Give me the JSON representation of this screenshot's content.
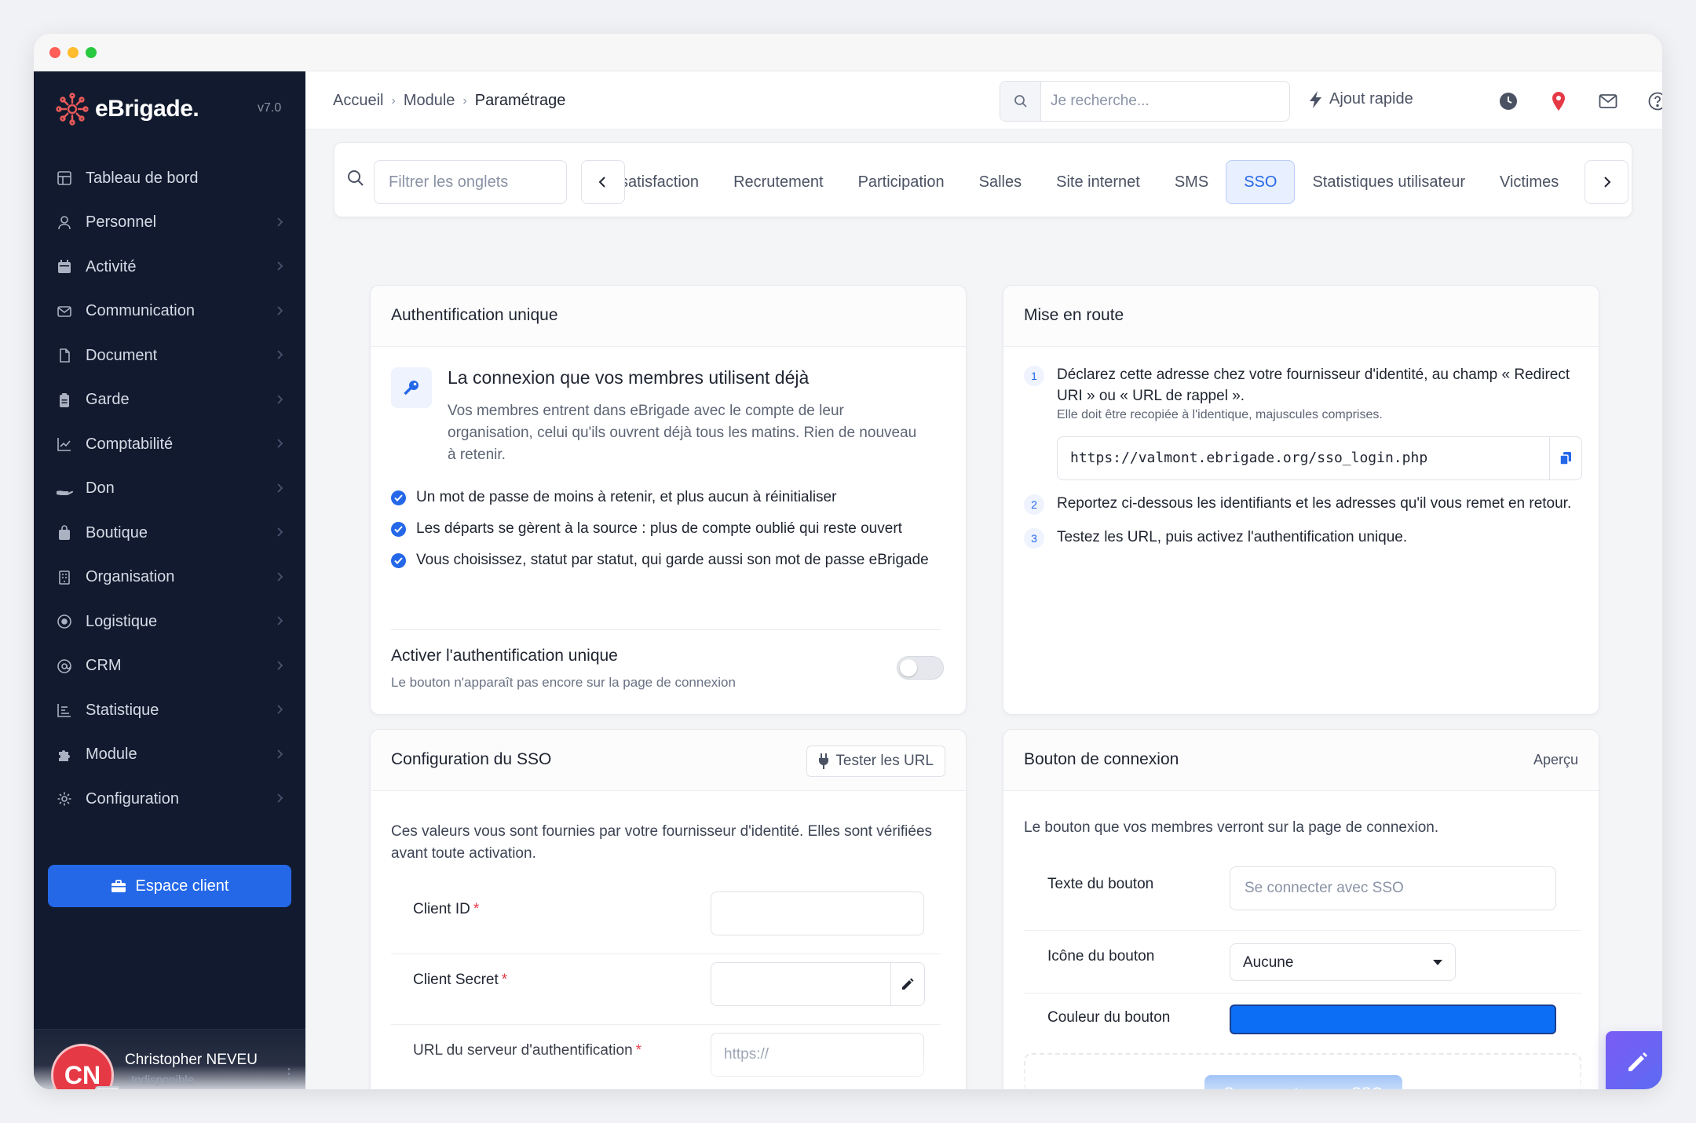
{
  "sidebar": {
    "brand": "eBrigade.",
    "version": "v7.0",
    "items": [
      {
        "label": "Tableau de bord",
        "icon": "dashboard-icon"
      },
      {
        "label": "Personnel",
        "icon": "user-icon"
      },
      {
        "label": "Activité",
        "icon": "calendar-icon"
      },
      {
        "label": "Communication",
        "icon": "mail-icon"
      },
      {
        "label": "Document",
        "icon": "document-icon"
      },
      {
        "label": "Garde",
        "icon": "clipboard-icon"
      },
      {
        "label": "Comptabilité",
        "icon": "chart-line-icon"
      },
      {
        "label": "Don",
        "icon": "hand-icon"
      },
      {
        "label": "Boutique",
        "icon": "shopping-bag-icon"
      },
      {
        "label": "Organisation",
        "icon": "building-icon"
      },
      {
        "label": "Logistique",
        "icon": "target-icon"
      },
      {
        "label": "CRM",
        "icon": "at-icon"
      },
      {
        "label": "Statistique",
        "icon": "bar-list-icon"
      },
      {
        "label": "Module",
        "icon": "puzzle-icon"
      },
      {
        "label": "Configuration",
        "icon": "gear-icon"
      }
    ],
    "client_button": "Espace client",
    "user": {
      "initials": "CN",
      "name": "Christopher NEVEU",
      "status": "Indisponible"
    }
  },
  "topbar": {
    "breadcrumbs": [
      "Accueil",
      "Module",
      "Paramétrage"
    ],
    "search_placeholder": "Je recherche...",
    "quick_add": "Ajout rapide"
  },
  "tabs": {
    "filter_placeholder": "Filtrer les onglets",
    "items": [
      "satisfaction",
      "Recrutement",
      "Participation",
      "Salles",
      "Site internet",
      "SMS",
      "SSO",
      "Statistiques utilisateur",
      "Victimes"
    ],
    "active": "SSO"
  },
  "auth_card": {
    "title": "Authentification unique",
    "heading": "La connexion que vos membres utilisent déjà",
    "description": "Vos membres entrent dans eBrigade avec le compte de leur organisation, celui qu'ils ouvrent déjà tous les matins. Rien de nouveau à retenir.",
    "benefits": [
      "Un mot de passe de moins à retenir, et plus aucun à réinitialiser",
      "Les départs se gèrent à la source : plus de compte oublié qui reste ouvert",
      "Vous choisissez, statut par statut, qui garde aussi son mot de passe eBrigade"
    ],
    "toggle_label": "Activer l'authentification unique",
    "toggle_sub": "Le bouton n'apparaît pas encore sur la page de connexion",
    "toggle_on": false
  },
  "setup_card": {
    "title": "Mise en route",
    "step1": "Déclarez cette adresse chez votre fournisseur d'identité, au champ « Redirect URI » ou « URL de rappel ».",
    "step1_sub": "Elle doit être recopiée à l'identique, majuscules comprises.",
    "redirect_url": "https://valmont.ebrigade.org/sso_login.php",
    "step2": "Reportez ci-dessous les identifiants et les adresses qu'il vous remet en retour.",
    "step3": "Testez les URL, puis activez l'authentification unique."
  },
  "config_card": {
    "title": "Configuration du SSO",
    "test_button": "Tester les URL",
    "description": "Ces valeurs vous sont fournies par votre fournisseur d'identité. Elles sont vérifiées avant toute activation.",
    "fields": [
      {
        "label": "Client ID",
        "value": "",
        "placeholder": ""
      },
      {
        "label": "Client Secret",
        "value": "",
        "placeholder": ""
      },
      {
        "label": "URL du serveur d'authentification",
        "value": "",
        "placeholder": "https://"
      }
    ]
  },
  "button_card": {
    "title": "Bouton de connexion",
    "extra": "Aperçu",
    "description": "Le bouton que vos membres verront sur la page de connexion.",
    "text_label": "Texte du bouton",
    "text_placeholder": "Se connecter avec SSO",
    "icon_label": "Icône du bouton",
    "icon_value": "Aucune",
    "color_label": "Couleur du bouton",
    "color_value": "#0b6ef5",
    "preview_button": "Se connecter avec SSO"
  }
}
